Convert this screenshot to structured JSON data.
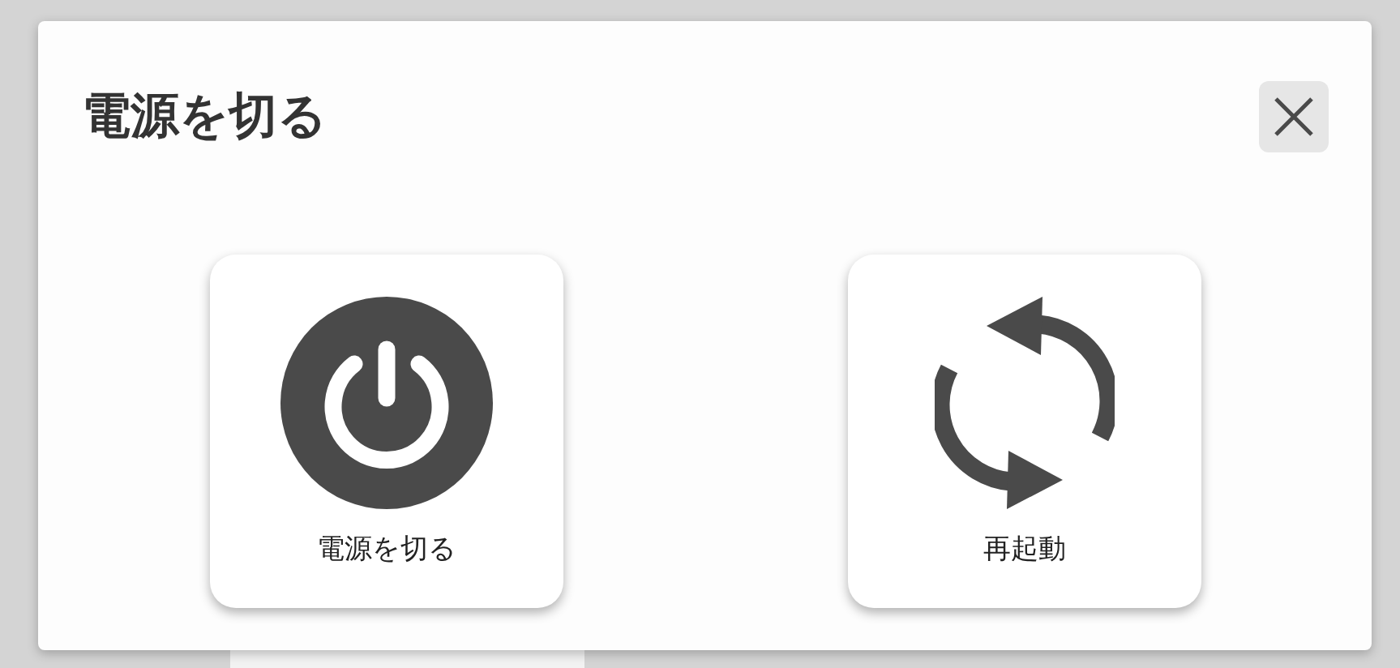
{
  "dialog": {
    "title": "電源を切る",
    "options": [
      {
        "kind": "power",
        "label": "電源を切る"
      },
      {
        "kind": "restart",
        "label": "再起動"
      }
    ]
  }
}
